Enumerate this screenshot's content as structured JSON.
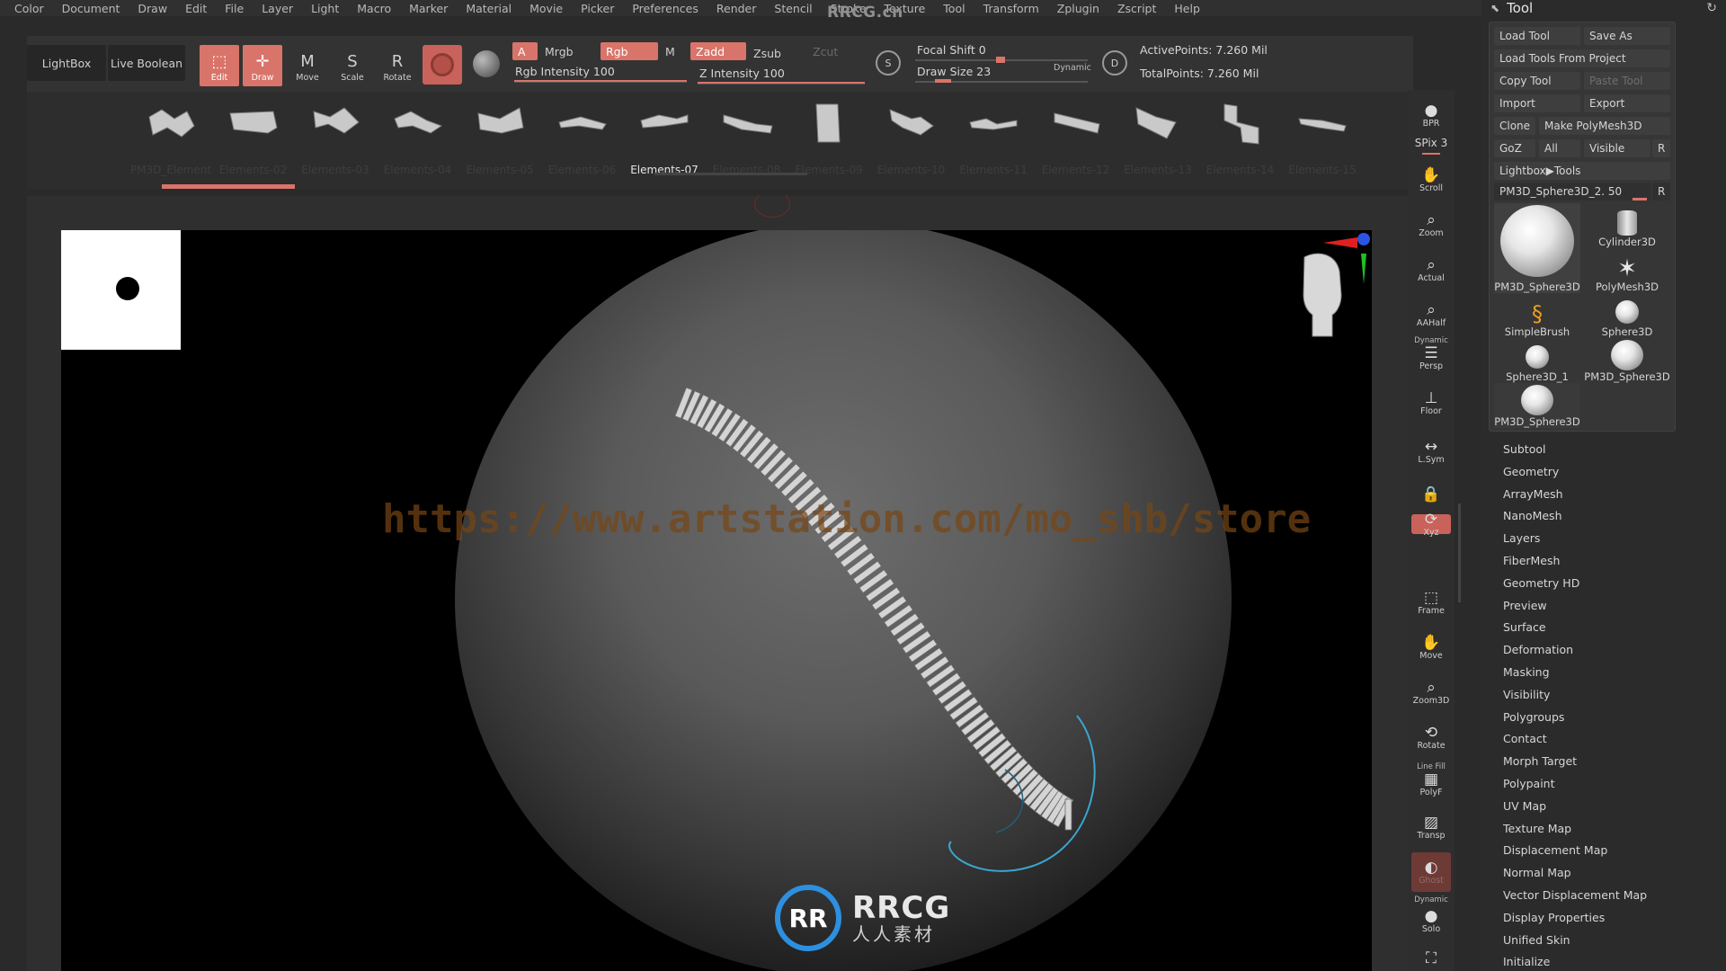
{
  "menu": {
    "items": [
      "Color",
      "Document",
      "Draw",
      "Edit",
      "File",
      "Layer",
      "Light",
      "Macro",
      "Marker",
      "Material",
      "Movie",
      "Picker",
      "Preferences",
      "Render",
      "Stencil",
      "Stroke",
      "Texture",
      "Tool",
      "Transform",
      "Zplugin",
      "Zscript",
      "Help"
    ],
    "watermark": "RRCG.cn"
  },
  "shelf": {
    "lightbox": "LightBox",
    "live_boolean": "Live Boolean",
    "modes": [
      {
        "label": "Edit",
        "icon": "edit-icon",
        "glyph": "⬚"
      },
      {
        "label": "Draw",
        "icon": "draw-icon",
        "glyph": "✎"
      },
      {
        "label": "Move",
        "icon": "move-icon",
        "glyph": "M"
      },
      {
        "label": "Scale",
        "icon": "scale-icon",
        "glyph": "S"
      },
      {
        "label": "Rotate",
        "icon": "rotate-icon",
        "glyph": "R"
      }
    ],
    "a_chip": "A",
    "mrgb": "Mrgb",
    "rgb": "Rgb",
    "m": "M",
    "zadd": "Zadd",
    "zsub": "Zsub",
    "zcut": "Zcut",
    "rgb_intensity": {
      "label": "Rgb Intensity 100",
      "value": 100
    },
    "z_intensity": {
      "label": "Z Intensity 100",
      "value": 100
    },
    "focal_shift": {
      "label": "Focal Shift 0",
      "value": 0
    },
    "draw_size": {
      "label": "Draw Size 23",
      "value": 23
    },
    "dynamic": "Dynamic",
    "s_icon_label": "S",
    "d_icon_label": "D",
    "active_points": "ActivePoints: 7.260 Mil",
    "total_points": "TotalPoints: 7.260 Mil"
  },
  "elements": {
    "items": [
      "PM3D_Element",
      "Elements-02",
      "Elements-03",
      "Elements-04",
      "Elements-05",
      "Elements-06",
      "Elements-07",
      "Elements-08",
      "Elements-09",
      "Elements-10",
      "Elements-11",
      "Elements-12",
      "Elements-13",
      "Elements-14",
      "Elements-15"
    ],
    "selected_index": 6
  },
  "canvas": {
    "url_watermark": "https://www.artstation.com/mo_shb/store",
    "logo_big": "RRCG",
    "logo_small": "人人素材",
    "logo_mark": "RR"
  },
  "rightcol": {
    "spix": "SPix 3",
    "buttons": [
      {
        "label": "BPR",
        "icon": "bpr-icon",
        "glyph": "●"
      },
      {
        "label": "Scroll",
        "icon": "scroll-icon",
        "glyph": "✋"
      },
      {
        "label": "Zoom",
        "icon": "zoom-icon",
        "glyph": "⌕"
      },
      {
        "label": "Actual",
        "icon": "actual-icon",
        "glyph": "⌕"
      },
      {
        "label": "AAHalf",
        "icon": "aahalf-icon",
        "glyph": "⌕"
      },
      {
        "label": "Persp",
        "icon": "persp-icon",
        "glyph": "☰"
      },
      {
        "label": "Floor",
        "icon": "floor-icon",
        "glyph": "⊥"
      },
      {
        "label": "L.Sym",
        "icon": "lsym-icon",
        "glyph": "↔"
      },
      {
        "label": "",
        "icon": "lock-icon",
        "glyph": "🔒"
      },
      {
        "label": "Xyz",
        "icon": "xyz-icon",
        "glyph": "⟳"
      },
      {
        "label": "Frame",
        "icon": "frame-icon",
        "glyph": "⬚"
      },
      {
        "label": "Move",
        "icon": "move-view-icon",
        "glyph": "✋"
      },
      {
        "label": "Zoom3D",
        "icon": "zoom3d-icon",
        "glyph": "⌕"
      },
      {
        "label": "Rotate",
        "icon": "rotate-view-icon",
        "glyph": "⟲"
      },
      {
        "label": "PolyF",
        "icon": "polyf-icon",
        "glyph": "▦"
      },
      {
        "label": "Transp",
        "icon": "transp-icon",
        "glyph": "▨"
      },
      {
        "label": "Ghost",
        "icon": "ghost-icon",
        "glyph": "◐"
      },
      {
        "label": "Solo",
        "icon": "solo-icon",
        "glyph": "●"
      },
      {
        "label": "",
        "icon": "xpose-icon",
        "glyph": "⛶"
      }
    ],
    "persp_top": "Dynamic",
    "polyf_top": "Line Fill",
    "solo_top": "Dynamic"
  },
  "tool": {
    "title": "Tool",
    "load_tool": "Load Tool",
    "save_as": "Save As",
    "load_from_project": "Load Tools From Project",
    "copy_tool": "Copy Tool",
    "paste_tool": "Paste Tool",
    "import": "Import",
    "export": "Export",
    "clone": "Clone",
    "make_polymesh": "Make PolyMesh3D",
    "goz": "GoZ",
    "all": "All",
    "visible": "Visible",
    "r": "R",
    "lightbox_tools": "Lightbox▶Tools",
    "current_tool": "PM3D_Sphere3D_2. 50",
    "thumbs": [
      "PM3D_Sphere3D",
      "Cylinder3D",
      "PolyMesh3D",
      "SimpleBrush",
      "Sphere3D",
      "Sphere3D_1",
      "PM3D_Sphere3D",
      "PM3D_Sphere3D"
    ],
    "subpalettes": [
      "Subtool",
      "Geometry",
      "ArrayMesh",
      "NanoMesh",
      "Layers",
      "FiberMesh",
      "Geometry HD",
      "Preview",
      "Surface",
      "Deformation",
      "Masking",
      "Visibility",
      "Polygroups",
      "Contact",
      "Morph Target",
      "Polypaint",
      "UV Map",
      "Texture Map",
      "Displacement Map",
      "Normal Map",
      "Vector Displacement Map",
      "Display Properties",
      "Unified Skin",
      "Initialize"
    ]
  },
  "colors": {
    "accent": "#d9746a",
    "background": "#2a2a2a",
    "canvas": "#000000",
    "brush_ring": "#3aa6d0"
  }
}
